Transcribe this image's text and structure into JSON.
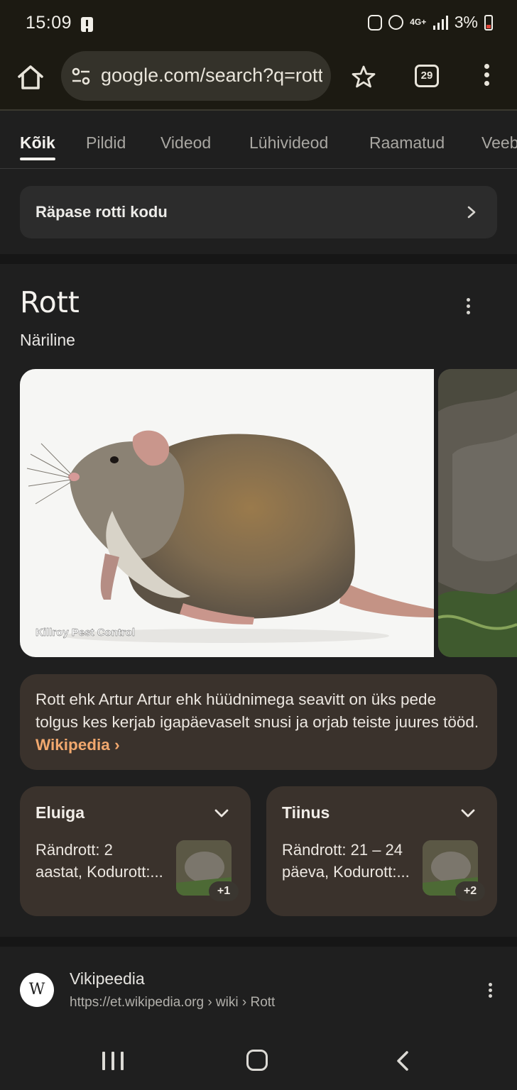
{
  "status_bar": {
    "time": "15:09",
    "network": "4G+",
    "battery": "3%"
  },
  "browser": {
    "url": "google.com/search?q=rott",
    "tab_count": "29"
  },
  "search_tabs": [
    "Kõik",
    "Pildid",
    "Videod",
    "Lühivideod",
    "Raamatud",
    "Veebid"
  ],
  "active_tab_index": 0,
  "related_search": "Räpase rotti kodu",
  "knowledge_panel": {
    "title": "Rott",
    "subtitle": "Näriline",
    "image_caption": "Killroy Pest Control",
    "description": "Rott ehk Artur Artur ehk hüüdnimega seavitt on üks pede tolgus kes kerjab igapäevaselt snusi ja orjab teiste juures tööd.",
    "source_link": "Wikipedia",
    "facts": [
      {
        "title": "Eluiga",
        "value": "Rändrott: 2 aastat, Kodurott:...",
        "badge": "+1"
      },
      {
        "title": "Tiinus",
        "value": "Rändrott: 21 – 24 päeva, Kodurott:...",
        "badge": "+2"
      }
    ]
  },
  "result": {
    "favicon": "W",
    "site": "Vikipeedia",
    "url": "https://et.wikipedia.org › wiki › Rott"
  },
  "colors": {
    "toolbar_bg": "#1c1a12",
    "card_bg": "#3a322c",
    "link_color": "#f1a86e",
    "page_bg": "#1f1f1f"
  },
  "icons": [
    "home-icon",
    "tune-icon",
    "star-icon",
    "tabs-icon",
    "more-vert-icon",
    "chevron-right-icon",
    "chevron-down-icon",
    "nav-recents-icon",
    "nav-home-icon",
    "nav-back-icon"
  ]
}
